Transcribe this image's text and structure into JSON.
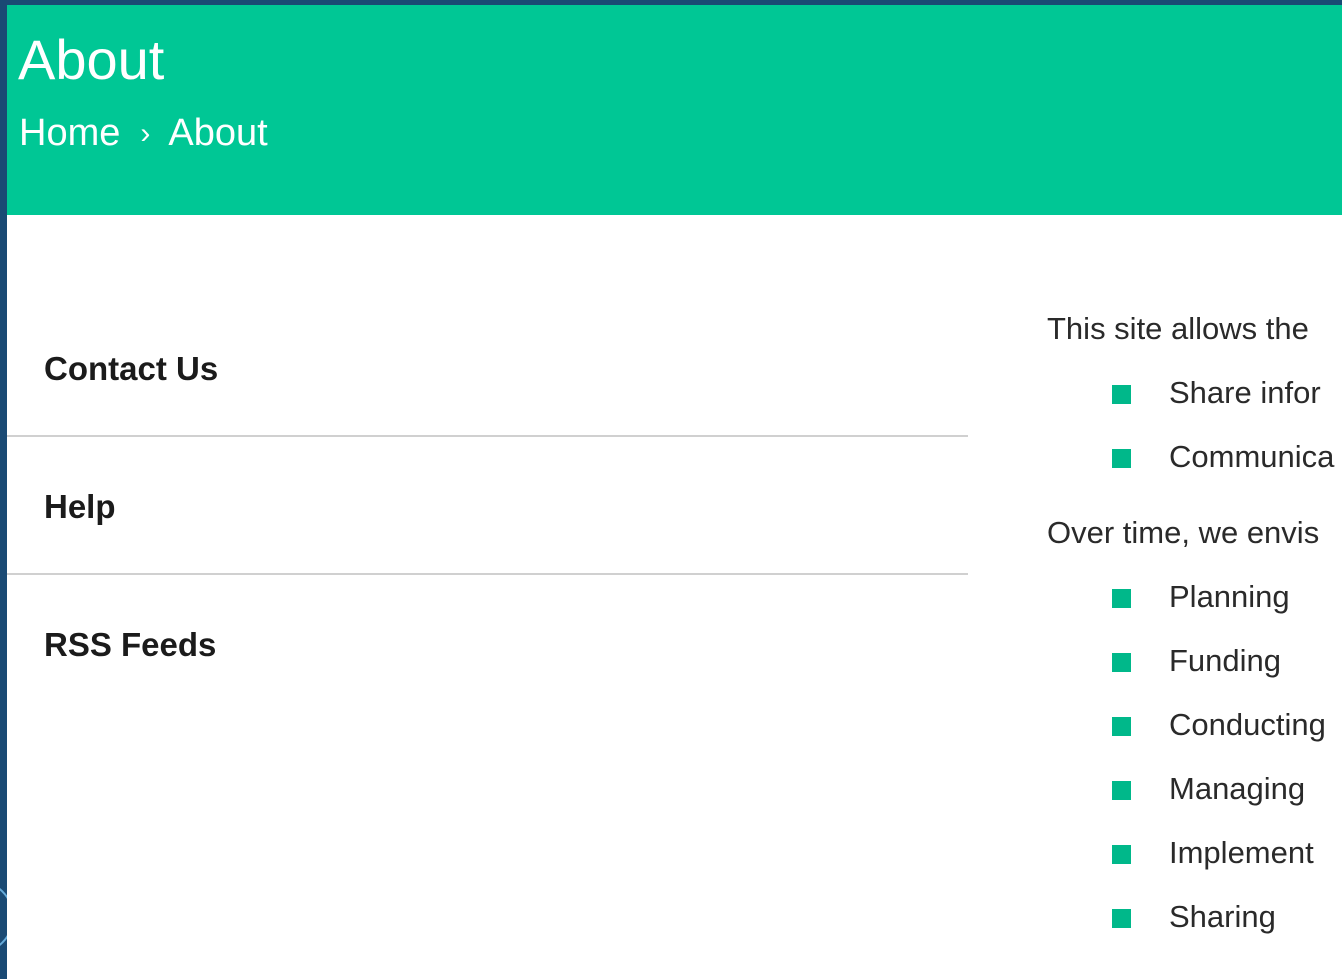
{
  "header": {
    "title": "About",
    "breadcrumb": {
      "home": "Home",
      "separator": "›",
      "current": "About"
    }
  },
  "sidebar": {
    "items": [
      {
        "label": "Contact Us"
      },
      {
        "label": "Help"
      },
      {
        "label": "RSS Feeds"
      }
    ]
  },
  "content": {
    "intro": "This site allows the",
    "list_a": [
      "Share infor",
      "Communica"
    ],
    "paragraph2": "Over time, we envis",
    "list_b": [
      "Planning",
      "Funding",
      "Conducting",
      "Managing",
      "Implement",
      "Sharing"
    ]
  },
  "colors": {
    "header_bg": "#00c795",
    "bullet": "#00b88a",
    "frame": "#1a4a74",
    "divider": "#d0d0d0"
  },
  "icons": {
    "bullet": "square-bullet-icon",
    "breadcrumb_separator": "chevron-right-icon"
  }
}
